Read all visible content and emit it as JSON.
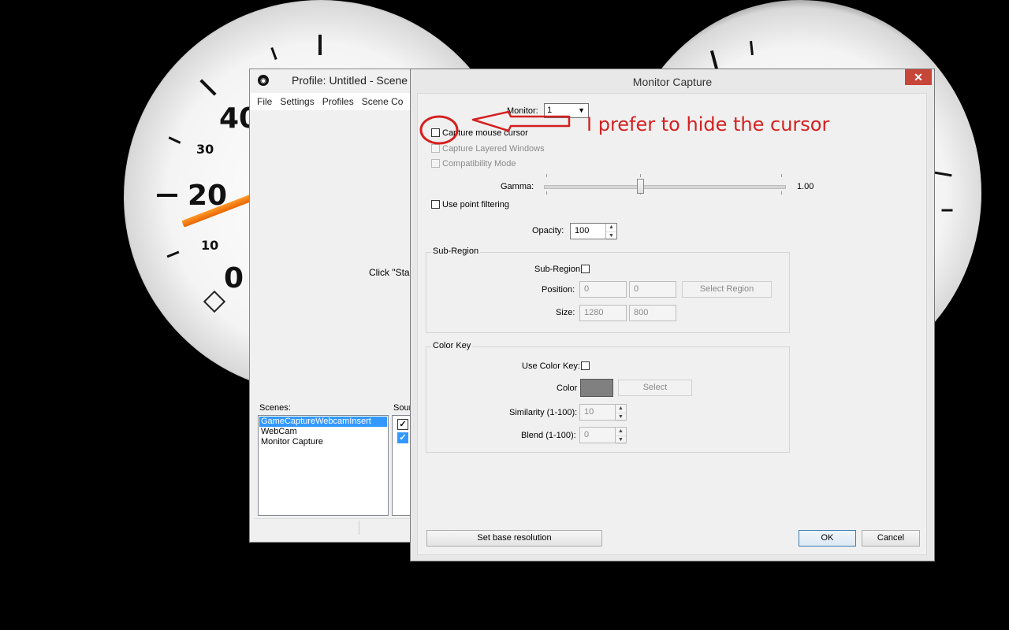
{
  "background": {
    "left_gauge": {
      "labels": [
        "40",
        "30",
        "20",
        "10",
        "0"
      ],
      "needle_color": "#f07a10"
    },
    "right_gauge": {
      "labels": []
    }
  },
  "obs_window": {
    "title": "Profile: Untitled - Scene",
    "menu": [
      "File",
      "Settings",
      "Profiles",
      "Scene Co"
    ],
    "preview_text": "Click \"Start",
    "scenes_label": "Scenes:",
    "sources_label": "Sour",
    "scenes": [
      "GameCaptureWebcamInsert",
      "WebCam",
      "Monitor Capture"
    ],
    "selected_scene": "GameCaptureWebcamInsert",
    "sources_checked": [
      true,
      true
    ]
  },
  "dialog": {
    "title": "Monitor Capture",
    "close_glyph": "✕",
    "monitor_label": "Monitor:",
    "monitor_value": "1",
    "capture_cursor_label": "Capture mouse cursor",
    "capture_cursor_checked": false,
    "layered_windows_label": "Capture Layered Windows",
    "compat_mode_label": "Compatibility Mode",
    "gamma_label": "Gamma:",
    "gamma_value": "1.00",
    "point_filter_label": "Use point filtering",
    "opacity_label": "Opacity:",
    "opacity_value": "100",
    "subregion": {
      "group_title": "Sub-Region",
      "enable_label": "Sub-Region",
      "position_label": "Position:",
      "pos_x": "0",
      "pos_y": "0",
      "select_region_label": "Select Region",
      "size_label": "Size:",
      "width": "1280",
      "height": "800"
    },
    "colorkey": {
      "group_title": "Color Key",
      "enable_label": "Use Color Key:",
      "color_label": "Color",
      "color_value": "#808080",
      "select_label": "Select",
      "similarity_label": "Similarity (1-100):",
      "similarity_value": "10",
      "blend_label": "Blend (1-100):",
      "blend_value": "0"
    },
    "set_base_label": "Set base resolution",
    "ok_label": "OK",
    "cancel_label": "Cancel"
  },
  "annotation": {
    "text": "I prefer to hide the cursor",
    "color": "#d42020"
  }
}
